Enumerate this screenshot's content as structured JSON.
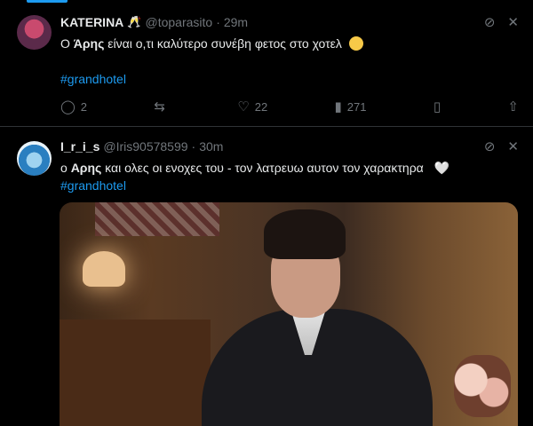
{
  "tweets": [
    {
      "name": "KATERINA",
      "name_badge": "🥂",
      "handle": "@toparasito",
      "separator": "·",
      "time": "29m",
      "text_before": "Ο ",
      "text_bold": "Άρης",
      "text_after": " είναι  ο,τι καλύτερο συνέβη φετος στο χοτελ",
      "hashtag": "#grandhotel",
      "replies": "2",
      "retweets": "",
      "likes": "22",
      "views": "271",
      "icons": [
        "grok-icon",
        "close-icon",
        "reply-icon",
        "retweet-icon",
        "like-icon",
        "views-icon",
        "bookmark-icon",
        "share-icon"
      ]
    },
    {
      "name": "I_r_i_s",
      "handle": "@Iris90578599",
      "separator": "·",
      "time": "30m",
      "text_before": "ο ",
      "text_bold": "Αρης",
      "text_after": " και ολες οι ενοχες του - τον λατρευω αυτον τον χαρακτηρα",
      "heart": "🤍",
      "hashtag": "#grandhotel"
    }
  ],
  "colors": {
    "background": "#000000",
    "text": "#e7e9ea",
    "muted": "#71767b",
    "link": "#1d9bf0",
    "divider": "#2f3336"
  }
}
